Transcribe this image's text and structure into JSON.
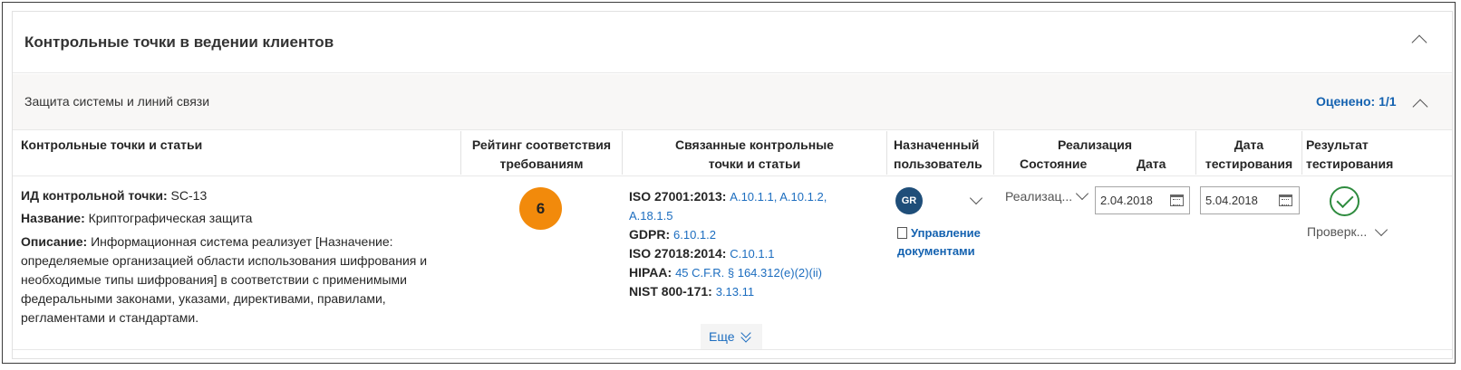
{
  "card": {
    "title": "Контрольные точки в ведении клиентов"
  },
  "section": {
    "title": "Защита системы и линий связи",
    "assessed": "Оценено: 1/1"
  },
  "columns": {
    "control": "Контрольные точки и статьи",
    "rating_1": "Рейтинг соответствия",
    "rating_2": "требованиям",
    "related_1": "Связанные контрольные",
    "related_2": "точки и статьи",
    "assigned_1": "Назначенный",
    "assigned_2": "пользователь",
    "impl": "Реализация",
    "impl_status": "Состояние",
    "impl_date": "Дата",
    "test_date_1": "Дата",
    "test_date_2": "тестирования",
    "result_1": "Результат",
    "result_2": "тестирования"
  },
  "row": {
    "id_label": "ИД контрольной точки:",
    "id_value": "SC-13",
    "name_label": "Название:",
    "name_value": "Криптографическая защита",
    "desc_label": "Описание:",
    "desc_value": "Информационная система реализует [Назначение: определяемые организацией области использования шифрования и необходимые типы шифрования] в соответствии с применимыми федеральными законами, указами, директивами, правилами, регламентами и стандартами.",
    "rating": "6",
    "refs": {
      "iso27001": "ISO 27001:2013:",
      "iso27001_l1": "A.10.1.1",
      "comma1": ", ",
      "iso27001_l2": "A.10.1.2",
      "comma2": ",",
      "iso27001_l3": "A.18.1.5",
      "gdpr": "GDPR:",
      "gdpr_l1": "6.10.1.2",
      "iso27018": "ISO 27018:2014:",
      "iso27018_l1": "C.10.1.1",
      "hipaa": "HIPAA:",
      "hipaa_l1": "45 C.F.R. § 164.312(e)(2)(ii)",
      "nist": "NIST 800-171:",
      "nist_l1": "3.13.11"
    },
    "more": "Еще",
    "avatar_initials": "GR",
    "manage_docs_1": "Управление",
    "manage_docs_2": "документами",
    "impl_status": "Реализац...",
    "impl_date": "2.04.2018",
    "test_date": "5.04.2018",
    "result_status": "Проверк..."
  },
  "colors": {
    "accent": "#1462b0",
    "rating_badge": "#f28a0b",
    "pass": "#2e8b3e",
    "avatar": "#1f4e79"
  }
}
